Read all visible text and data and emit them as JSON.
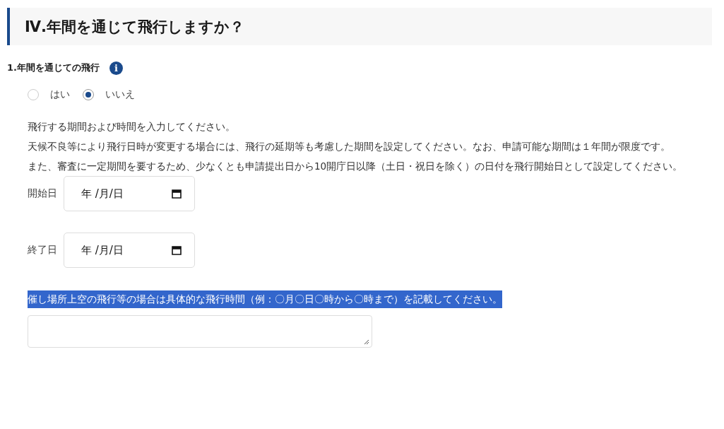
{
  "section": {
    "title": "Ⅳ.年間を通じて飛行しますか？"
  },
  "question": {
    "label": "1.年間を通じての飛行",
    "info_icon": "i"
  },
  "options": [
    {
      "label": "はい",
      "selected": false
    },
    {
      "label": "いいえ",
      "selected": true
    }
  ],
  "instructions": [
    "飛行する期間および時間を入力してください。",
    "天候不良等により飛行日時が変更する場合には、飛行の延期等も考慮した期間を設定してください。なお、申請可能な期間は１年間が限度です。",
    "また、審査に一定期間を要するため、少なくとも申請提出日から10開庁日以降（土日・祝日を除く）の日付を飛行開始日として設定してください。"
  ],
  "date_fields": [
    {
      "label": "開始日",
      "placeholder": "年 /月/日"
    },
    {
      "label": "終了日",
      "placeholder": "年 /月/日"
    }
  ],
  "note": {
    "text": "催し場所上空の飛行等の場合は具体的な飛行時間（例：〇月〇日〇時から〇時まで）を記載してください。",
    "highlighted": true
  }
}
